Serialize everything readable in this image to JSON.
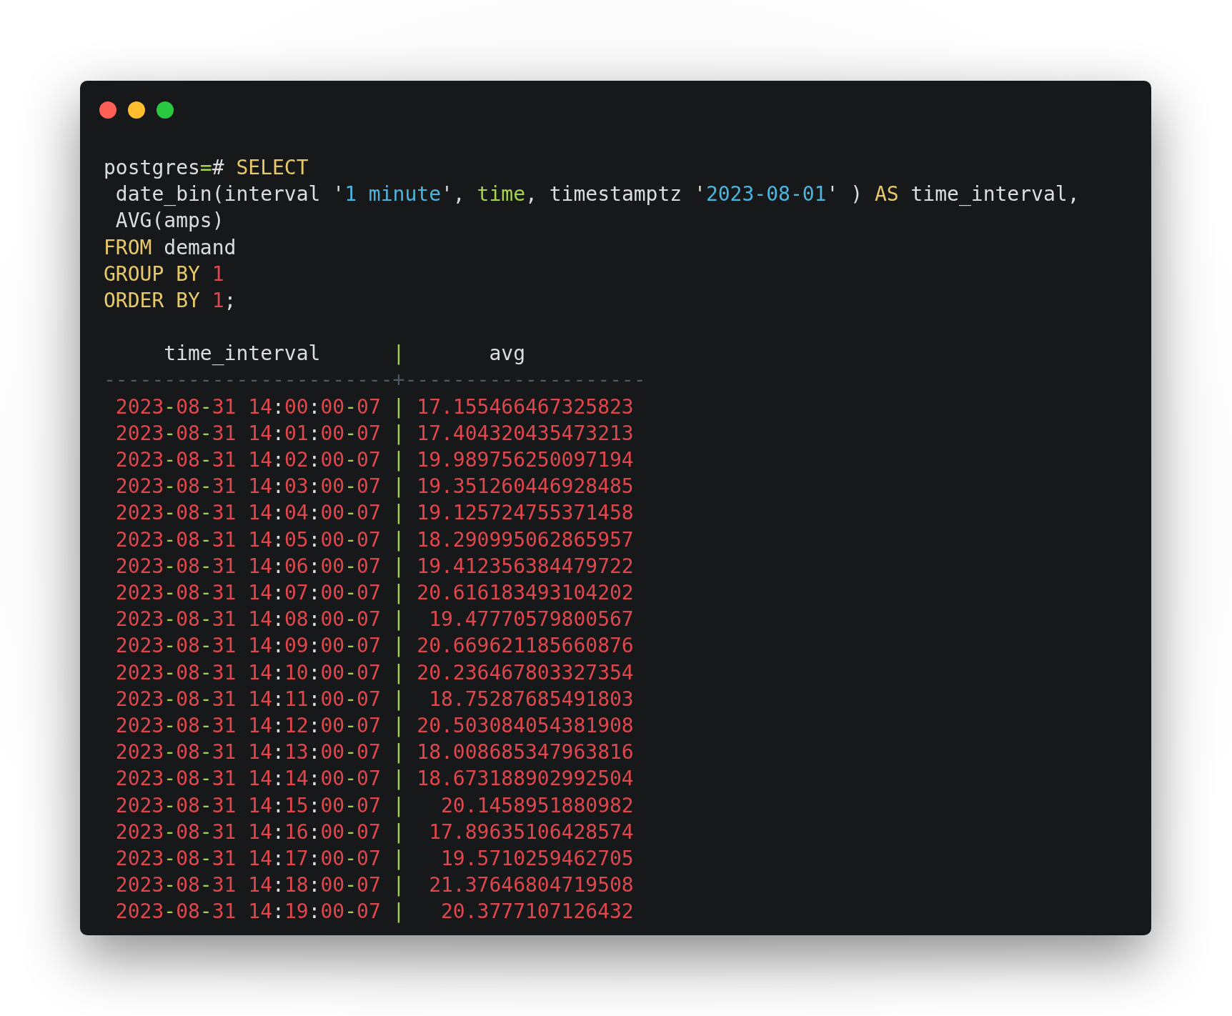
{
  "window": {
    "controls": [
      {
        "color": "#fe5f57"
      },
      {
        "color": "#febc2e"
      },
      {
        "color": "#28c840"
      }
    ]
  },
  "query": [
    [
      {
        "text": "postgres",
        "kind": "plain"
      },
      {
        "text": "=",
        "kind": "operator"
      },
      {
        "text": "# ",
        "kind": "plain"
      },
      {
        "text": "SELECT",
        "kind": "keyword"
      }
    ],
    [
      {
        "text": " date_bin(interval ",
        "kind": "plain"
      },
      {
        "text": "'",
        "kind": "plain"
      },
      {
        "text": "1 minute",
        "kind": "string"
      },
      {
        "text": "', ",
        "kind": "plain"
      },
      {
        "text": "time",
        "kind": "identifier"
      },
      {
        "text": ", timestamptz ",
        "kind": "plain"
      },
      {
        "text": "'",
        "kind": "plain"
      },
      {
        "text": "2023-08-01",
        "kind": "string"
      },
      {
        "text": "' ) ",
        "kind": "plain"
      },
      {
        "text": "AS",
        "kind": "keyword"
      },
      {
        "text": " time_interval,",
        "kind": "plain"
      }
    ],
    [
      {
        "text": " AVG(amps)",
        "kind": "plain"
      }
    ],
    [
      {
        "text": "FROM",
        "kind": "keyword"
      },
      {
        "text": " demand",
        "kind": "plain"
      }
    ],
    [
      {
        "text": "GROUP BY ",
        "kind": "keyword"
      },
      {
        "text": "1",
        "kind": "number"
      }
    ],
    [
      {
        "text": "ORDER BY ",
        "kind": "keyword"
      },
      {
        "text": "1",
        "kind": "number"
      },
      {
        "text": ";",
        "kind": "plain"
      }
    ]
  ],
  "table": {
    "columns": [
      "time_interval",
      "avg"
    ],
    "separator": "|",
    "rule": "------------------------+--------------------",
    "rows": [
      {
        "time_interval": "2023-08-31 14:00:00-07",
        "avg": "17.155466467325823"
      },
      {
        "time_interval": "2023-08-31 14:01:00-07",
        "avg": "17.404320435473213"
      },
      {
        "time_interval": "2023-08-31 14:02:00-07",
        "avg": "19.989756250097194"
      },
      {
        "time_interval": "2023-08-31 14:03:00-07",
        "avg": "19.351260446928485"
      },
      {
        "time_interval": "2023-08-31 14:04:00-07",
        "avg": "19.125724755371458"
      },
      {
        "time_interval": "2023-08-31 14:05:00-07",
        "avg": "18.290995062865957"
      },
      {
        "time_interval": "2023-08-31 14:06:00-07",
        "avg": "19.412356384479722"
      },
      {
        "time_interval": "2023-08-31 14:07:00-07",
        "avg": "20.616183493104202"
      },
      {
        "time_interval": "2023-08-31 14:08:00-07",
        "avg": "19.47770579800567"
      },
      {
        "time_interval": "2023-08-31 14:09:00-07",
        "avg": "20.669621185660876"
      },
      {
        "time_interval": "2023-08-31 14:10:00-07",
        "avg": "20.236467803327354"
      },
      {
        "time_interval": "2023-08-31 14:11:00-07",
        "avg": "18.75287685491803"
      },
      {
        "time_interval": "2023-08-31 14:12:00-07",
        "avg": "20.503084054381908"
      },
      {
        "time_interval": "2023-08-31 14:13:00-07",
        "avg": "18.008685347963816"
      },
      {
        "time_interval": "2023-08-31 14:14:00-07",
        "avg": "18.673188902992504"
      },
      {
        "time_interval": "2023-08-31 14:15:00-07",
        "avg": "20.1458951880982"
      },
      {
        "time_interval": "2023-08-31 14:16:00-07",
        "avg": "17.89635106428574"
      },
      {
        "time_interval": "2023-08-31 14:17:00-07",
        "avg": "19.5710259462705"
      },
      {
        "time_interval": "2023-08-31 14:18:00-07",
        "avg": "21.37646804719508"
      },
      {
        "time_interval": "2023-08-31 14:19:00-07",
        "avg": "20.3777107126432"
      }
    ]
  }
}
